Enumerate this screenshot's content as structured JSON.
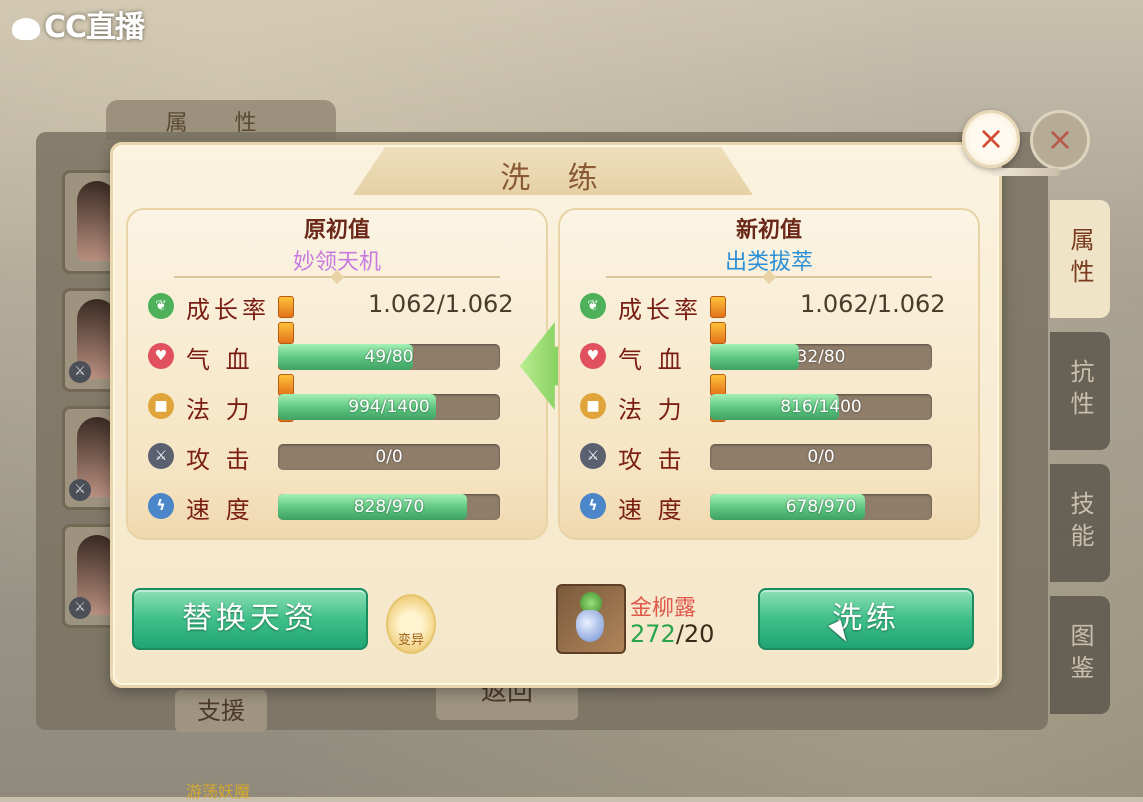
{
  "logo": {
    "text": "CC直播"
  },
  "background": {
    "attr_tab": "属 性",
    "support_button": "支援",
    "back_button": "返回",
    "bottom_label": "游荡妖魔",
    "side_tabs": [
      "属性",
      "抗性",
      "技能",
      "图鉴"
    ]
  },
  "dialog": {
    "title": "洗 练",
    "close_icon": "×",
    "left_panel": {
      "heading": "原初值",
      "tier": "妙领天机",
      "tier_color": "#c77be0",
      "growth": {
        "label": "成长率",
        "stars": 5,
        "value": "1.062/1.062"
      },
      "stats": [
        {
          "label": "气 血",
          "text": "49/80",
          "fill": 0.61,
          "icon": "heart-icon",
          "color": "#e0505e"
        },
        {
          "label": "法 力",
          "text": "994/1400",
          "fill": 0.71,
          "icon": "mana-icon",
          "color": "#e0a53a"
        },
        {
          "label": "攻 击",
          "text": "0/0",
          "fill": 0.0,
          "icon": "sword-icon",
          "color": "#5a6070"
        },
        {
          "label": "速 度",
          "text": "828/970",
          "fill": 0.85,
          "icon": "lightning-icon",
          "color": "#4a86c8"
        }
      ]
    },
    "right_panel": {
      "heading": "新初值",
      "tier": "出类拔萃",
      "tier_color": "#2a8fd6",
      "growth": {
        "label": "成长率",
        "stars": 5,
        "value": "1.062/1.062"
      },
      "stats": [
        {
          "label": "气 血",
          "text": "32/80",
          "fill": 0.4,
          "icon": "heart-icon",
          "color": "#e0505e"
        },
        {
          "label": "法 力",
          "text": "816/1400",
          "fill": 0.58,
          "icon": "mana-icon",
          "color": "#e0a53a"
        },
        {
          "label": "攻 击",
          "text": "0/0",
          "fill": 0.0,
          "icon": "sword-icon",
          "color": "#5a6070"
        },
        {
          "label": "速 度",
          "text": "678/970",
          "fill": 0.7,
          "icon": "lightning-icon",
          "color": "#4a86c8"
        }
      ]
    },
    "swap_button": "替换天资",
    "lock_badge": "变异",
    "item": {
      "name": "金柳露",
      "have": "272",
      "need": "/20"
    },
    "wash_button": "洗练"
  }
}
